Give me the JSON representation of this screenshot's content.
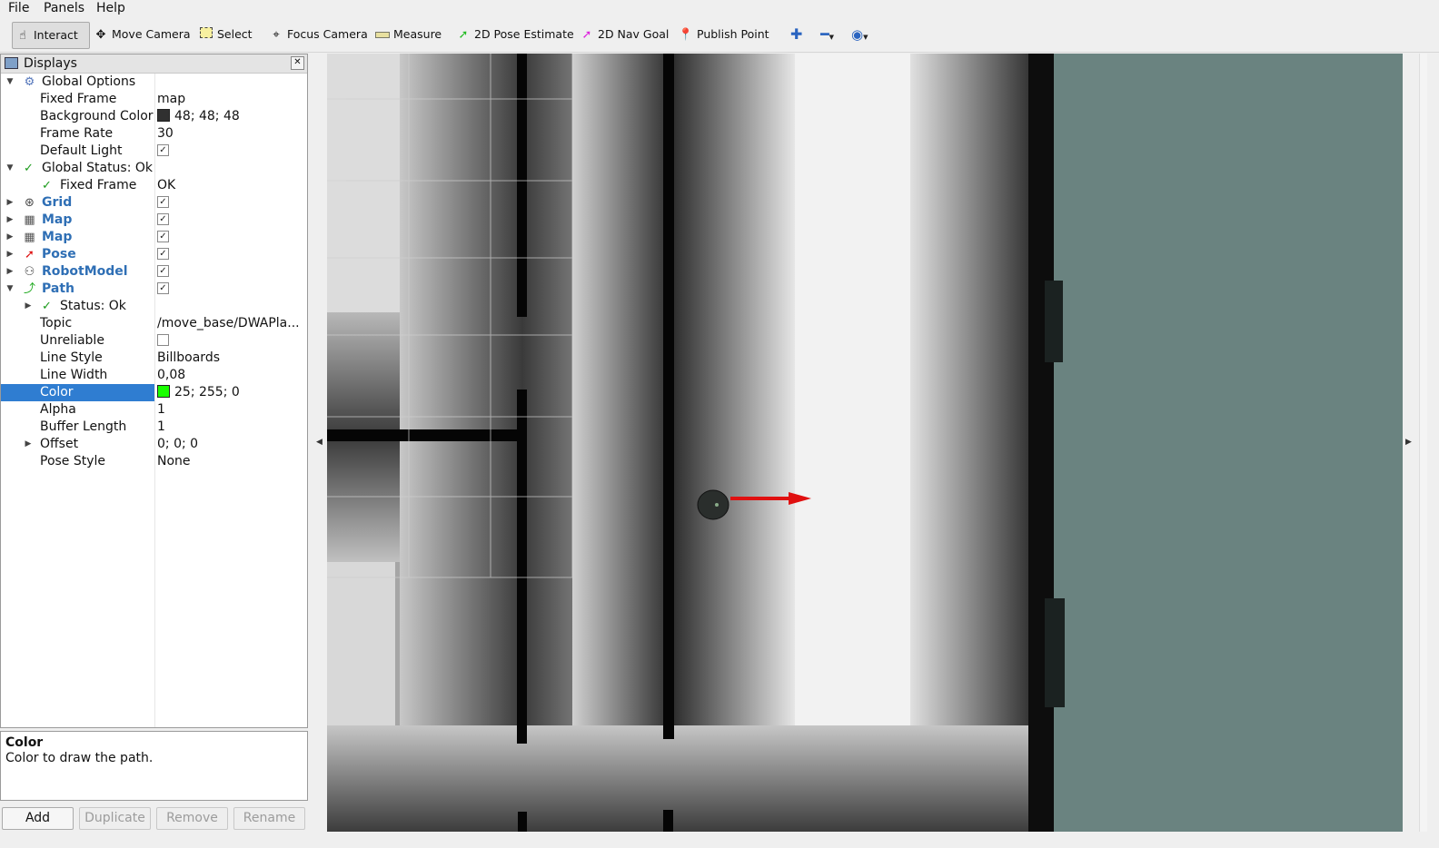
{
  "menubar": {
    "file": "File",
    "panels": "Panels",
    "help": "Help"
  },
  "toolbar": {
    "interact": "Interact",
    "move_camera": "Move Camera",
    "select": "Select",
    "focus_camera": "Focus Camera",
    "measure": "Measure",
    "pose_estimate": "2D Pose Estimate",
    "nav_goal": "2D Nav Goal",
    "publish_point": "Publish Point",
    "icons": {
      "interact": "hand-icon",
      "move_camera": "move-icon",
      "select": "select-icon",
      "focus_camera": "focus-icon",
      "measure": "ruler-icon",
      "pose_estimate": "green-arrow-icon",
      "nav_goal": "magenta-arrow-icon",
      "publish_point": "pin-icon",
      "zoom_in": "plus-icon",
      "zoom_out": "minus-icon",
      "view": "eye-icon"
    }
  },
  "displays": {
    "title": "Displays",
    "global_options": "Global Options",
    "fixed_frame_label": "Fixed Frame",
    "fixed_frame_value": "map",
    "bg_color_label": "Background Color",
    "bg_color_value": "48; 48; 48",
    "bg_color_hex": "#303030",
    "frame_rate_label": "Frame Rate",
    "frame_rate_value": "30",
    "default_light_label": "Default Light",
    "global_status": "Global Status: Ok",
    "status_fixed_frame": "Fixed Frame",
    "status_fixed_frame_value": "OK",
    "grid": "Grid",
    "map1": "Map",
    "map2": "Map",
    "pose": "Pose",
    "robot_model": "RobotModel",
    "path": "Path",
    "path_status": "Status: Ok",
    "topic_label": "Topic",
    "topic_value": "/move_base/DWAPla...",
    "unreliable_label": "Unreliable",
    "line_style_label": "Line Style",
    "line_style_value": "Billboards",
    "line_width_label": "Line Width",
    "line_width_value": "0,08",
    "color_label": "Color",
    "color_value": "25; 255; 0",
    "color_hex": "#19ff00",
    "alpha_label": "Alpha",
    "alpha_value": "1",
    "buffer_label": "Buffer Length",
    "buffer_value": "1",
    "offset_label": "Offset",
    "offset_value": "0; 0; 0",
    "pose_style_label": "Pose Style",
    "pose_style_value": "None",
    "check": "✓"
  },
  "description": {
    "title": "Color",
    "body": "Color to draw the path."
  },
  "buttons": {
    "add": "Add",
    "duplicate": "Duplicate",
    "remove": "Remove",
    "rename": "Rename"
  },
  "colors": {
    "accent": "#2f7dd1",
    "unknown_area": "#6a8380",
    "arrow": "#e01010"
  }
}
